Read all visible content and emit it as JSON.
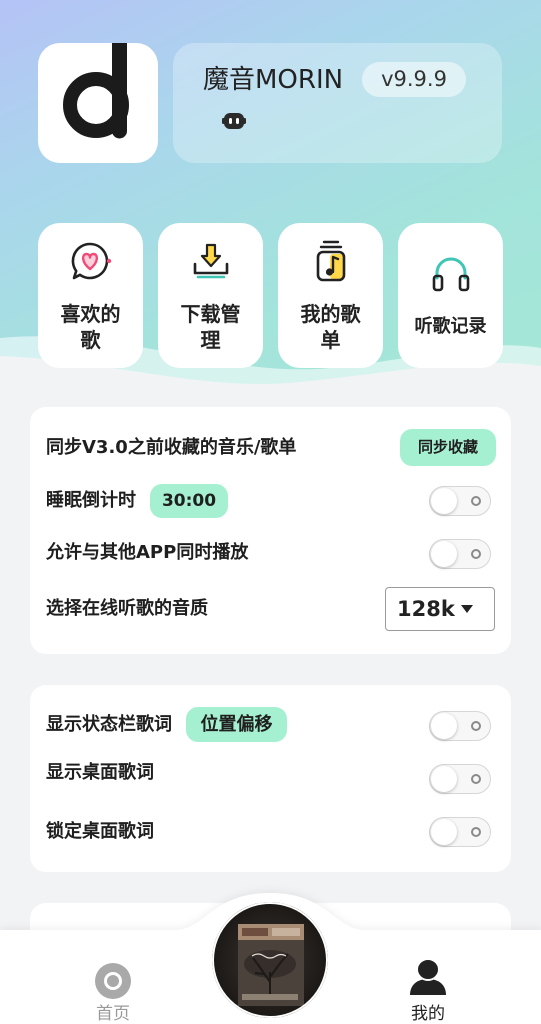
{
  "app": {
    "name": "魔音MORIN",
    "version": "v9.9.9",
    "logo_icon": "app-logo-d-icon",
    "badge_icon": "robot-icon"
  },
  "quick_actions": [
    {
      "label": "喜欢的歌",
      "icon": "heart-chat-icon"
    },
    {
      "label": "下载管理",
      "icon": "download-icon"
    },
    {
      "label": "我的歌单",
      "icon": "playlist-icon"
    },
    {
      "label": "听歌记录",
      "icon": "headphones-icon"
    }
  ],
  "settings_playback": {
    "sync_favorites": {
      "label": "同步V3.0之前收藏的音乐/歌单",
      "button": "同步收藏"
    },
    "sleep_timer": {
      "label": "睡眠倒计时",
      "time": "30:00",
      "enabled": false
    },
    "mix_with_other_apps": {
      "label": "允许与其他APP同时播放",
      "enabled": false
    },
    "online_quality": {
      "label": "选择在线听歌的音质",
      "value": "128k"
    }
  },
  "settings_lyrics": {
    "status_bar_lyrics": {
      "label": "显示状态栏歌词",
      "button": "位置偏移",
      "enabled": false
    },
    "desktop_lyrics": {
      "label": "显示桌面歌词",
      "enabled": false
    },
    "lock_desktop_lyrics": {
      "label": "锁定桌面歌词",
      "enabled": false
    }
  },
  "bottom_nav": {
    "items": [
      {
        "label": "首页",
        "icon": "disc-icon",
        "active": false
      },
      {
        "label": "我的",
        "icon": "user-icon",
        "active": true
      }
    ],
    "center_icon": "album-cover-icon"
  },
  "colors": {
    "accent_mint": "#a6f0d2",
    "text_primary": "#1f1f1f",
    "nav_inactive": "#9a9a9a",
    "nav_active": "#222222",
    "heart_pink": "#f04a78",
    "icon_yellow": "#ffd84a",
    "icon_teal": "#3fc6b4"
  }
}
